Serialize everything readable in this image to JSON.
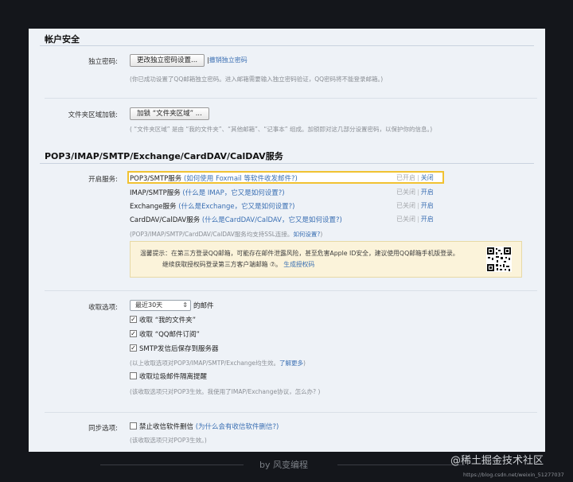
{
  "account_security": {
    "title": "帐户安全",
    "independent_password": {
      "label": "独立密码:",
      "change_button": "更改独立密码设置...",
      "revoke_link": "撤销独立密码",
      "note": "(你已成功设置了QQ邮箱独立密码。进入邮箱需要输入独立密码验证，QQ密码将不能登录邮箱。)"
    },
    "folder_lock": {
      "label": "文件夹区域加锁:",
      "button": "加锁 “文件夹区域” ...",
      "note": "( “文件夹区域” 是由 “我的文件夹”、“其他邮箱”、“记事本” 组成。加锁即对这几部分设置密码，以保护你的信息。)"
    }
  },
  "protocols": {
    "title": "POP3/IMAP/SMTP/Exchange/CardDAV/CalDAV服务",
    "enable_label": "开启服务:",
    "services": [
      {
        "name": "POP3/SMTP服务",
        "hint": "(如何使用 Foxmail 等软件收发邮件?)",
        "status_off": "已开启",
        "sep": "|",
        "action": "关闭",
        "highlight": true
      },
      {
        "name": "IMAP/SMTP服务",
        "hint": "(什么是 IMAP，它又是如何设置?)",
        "status_off": "已关闭",
        "sep": "|",
        "action": "开启",
        "highlight": false
      },
      {
        "name": "Exchange服务",
        "hint": "(什么是Exchange，它又是如何设置?)",
        "status_off": "已关闭",
        "sep": "|",
        "action": "开启",
        "highlight": false
      },
      {
        "name": "CardDAV/CalDAV服务",
        "hint": "(什么是CardDAV/CalDAV，它又是如何设置?)",
        "status_off": "已关闭",
        "sep": "|",
        "action": "开启",
        "highlight": false
      }
    ],
    "ssl_note": "(POP3/IMAP/SMTP/CardDAV/CalDAV服务均支持SSL连接。",
    "ssl_link": "如何设置?",
    "ssl_close": ")",
    "tip": {
      "line1": "温馨提示：在第三方登录QQ邮箱，可能存在邮件泄露风险，甚至危害Apple ID安全，建议使用QQ邮箱手机版登录。",
      "line2_prefix": "继续获取授权码登录第三方客户端邮箱 ⑦。",
      "line2_link": "生成授权码"
    }
  },
  "receive": {
    "label": "收取选项:",
    "range_value": "最近30天",
    "range_suffix": "的邮件",
    "options": [
      {
        "label": "收取 “我的文件夹”",
        "checked": true
      },
      {
        "label": "收取 “QQ邮件订阅”",
        "checked": true
      },
      {
        "label": "SMTP发信后保存到服务器",
        "checked": true
      }
    ],
    "note1": "(以上收取选项对POP3/IMAP/SMTP/Exchange均生效。",
    "note1_link": "了解更多",
    "note1_close": ")",
    "spam": {
      "label": "收取垃圾邮件隔离提醒",
      "checked": false
    },
    "note2": "(该收取选项只对POP3生效。我使用了IMAP/Exchange协议，怎么办? )"
  },
  "sync": {
    "label": "同步选项:",
    "option": {
      "label": "禁止收信软件删信",
      "checked": false
    },
    "hint": "(为什么会有收信软件删信?)",
    "note": "(该收取选项只对POP3生效。)"
  },
  "footer": {
    "caption": "by 风变编程",
    "watermark": "@稀土掘金技术社区",
    "watermark_url": "https://blog.csdn.net/weixin_51277037"
  }
}
